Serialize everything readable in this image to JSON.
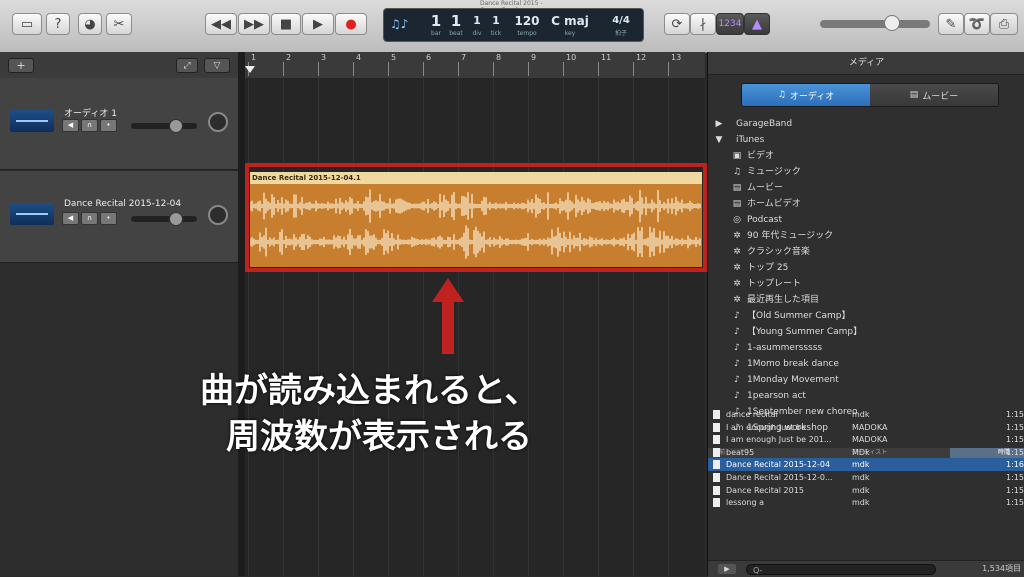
{
  "window": {
    "title": "Dance Recital 2015 - GarageBand"
  },
  "toolbar": {
    "left_icons": [
      "library-icon",
      "help-icon",
      "smart-controls-icon",
      "editors-icon"
    ],
    "transport": {
      "rewind": "◀◀",
      "forward": "▶▶",
      "stop": "■",
      "play": "▶",
      "record": "●"
    },
    "lcd": {
      "bar": "1",
      "beat": "1",
      "div": "1",
      "tick": "1",
      "tempo": "120",
      "key": "C maj",
      "time_sig_top": "4",
      "time_sig_bottom": "4",
      "labels": {
        "bar": "bar",
        "beat": "beat",
        "div": "div",
        "tick": "tick",
        "tempo": "tempo",
        "key": "key",
        "sig": "拍子"
      }
    },
    "right_buttons": {
      "count_in": "1234",
      "tuner": "tuner-icon"
    }
  },
  "tracks": {
    "header_add": "+",
    "items": [
      {
        "name": "オーディオ 1"
      },
      {
        "name": "Dance Recital 2015-12-04"
      }
    ]
  },
  "ruler": {
    "bars": [
      "1",
      "2",
      "3",
      "4",
      "5",
      "6",
      "7",
      "8",
      "9",
      "10",
      "11",
      "12",
      "13"
    ]
  },
  "region": {
    "title": "Dance Recital 2015-12-04.1",
    "color": "#c77f2f"
  },
  "annotation": {
    "line1": "曲が読み込まれると、",
    "line2": "周波数が表示される",
    "frame_color": "#c0231f"
  },
  "media": {
    "title": "メディア",
    "tabs": [
      {
        "label": "オーディオ",
        "active": true
      },
      {
        "label": "ムービー",
        "active": false
      }
    ],
    "tree": [
      {
        "label": "GarageBand",
        "level": 0,
        "icon": "▶"
      },
      {
        "label": "iTunes",
        "level": 0,
        "icon": "▼"
      },
      {
        "label": "ビデオ",
        "level": 1,
        "icon": "▣"
      },
      {
        "label": "ミュージック",
        "level": 1,
        "icon": "♫"
      },
      {
        "label": "ムービー",
        "level": 1,
        "icon": "▤"
      },
      {
        "label": "ホームビデオ",
        "level": 1,
        "icon": "▤"
      },
      {
        "label": "Podcast",
        "level": 1,
        "icon": "◎"
      },
      {
        "label": "90 年代ミュージック",
        "level": 1,
        "icon": "✲"
      },
      {
        "label": "クラシック音楽",
        "level": 1,
        "icon": "✲"
      },
      {
        "label": "トップ 25",
        "level": 1,
        "icon": "✲"
      },
      {
        "label": "トップレート",
        "level": 1,
        "icon": "✲"
      },
      {
        "label": "最近再生した項目",
        "level": 1,
        "icon": "✲"
      },
      {
        "label": "【Old Summer Camp】",
        "level": 1,
        "icon": "♪"
      },
      {
        "label": "【Young Summer Camp】",
        "level": 1,
        "icon": "♪"
      },
      {
        "label": "1-asummersssss",
        "level": 1,
        "icon": "♪"
      },
      {
        "label": "1Momo break dance",
        "level": 1,
        "icon": "♪"
      },
      {
        "label": "1Monday Movement",
        "level": 1,
        "icon": "♪"
      },
      {
        "label": "1pearson act",
        "level": 1,
        "icon": "♪"
      },
      {
        "label": "1September new choreo",
        "level": 1,
        "icon": "♪"
      },
      {
        "label": "1Spring workshop",
        "level": 1,
        "icon": "♪"
      }
    ],
    "columns": {
      "name": "名前",
      "artist": "アーティスト",
      "time": "時間"
    },
    "files": [
      {
        "name": "dance recital",
        "artist": "mdk",
        "time": "1:15",
        "selected": false
      },
      {
        "name": "I am enough Just be",
        "artist": "MADOKA",
        "time": "1:15",
        "selected": false
      },
      {
        "name": "I am enough Just be 201...",
        "artist": "MADOKA",
        "time": "1:15",
        "selected": false
      },
      {
        "name": "beat95",
        "artist": "MDk",
        "time": "1:15",
        "selected": false
      },
      {
        "name": "Dance Recital 2015-12-04",
        "artist": "mdk",
        "time": "1:16",
        "selected": true
      },
      {
        "name": "Dance Recital 2015-12-0...",
        "artist": "mdk",
        "time": "1:15",
        "selected": false
      },
      {
        "name": "Dance Recital 2015",
        "artist": "mdk",
        "time": "1:15",
        "selected": false
      },
      {
        "name": "lessong a",
        "artist": "mdk",
        "time": "1:15",
        "selected": false
      }
    ],
    "search_placeholder": "Q-",
    "count": "1,534項目"
  }
}
